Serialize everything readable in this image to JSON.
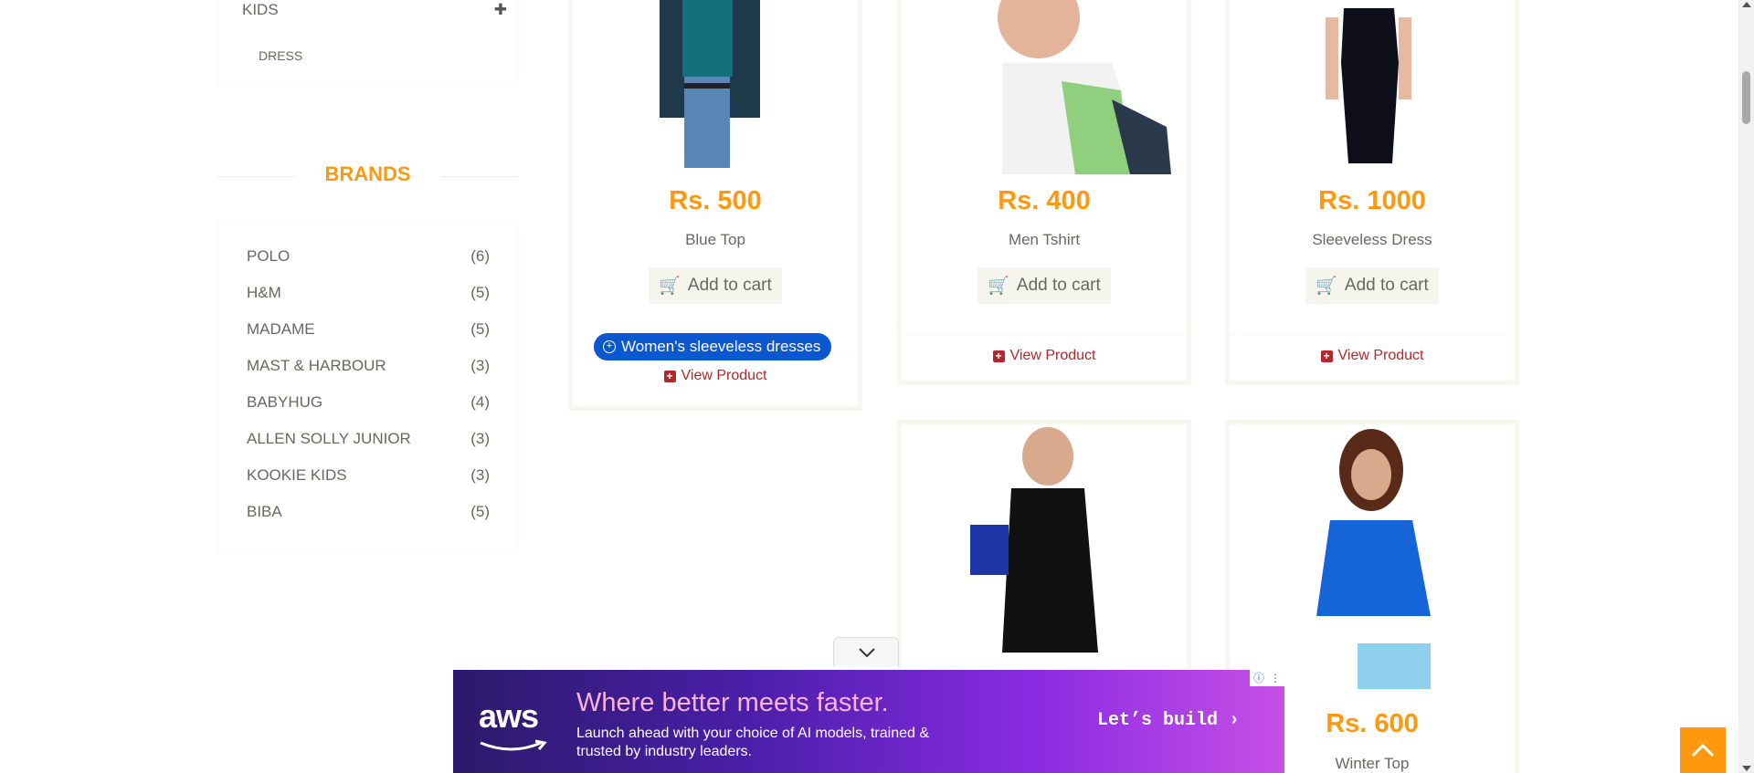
{
  "sidebar": {
    "category": {
      "label": "KIDS",
      "sub_item": "DRESS"
    },
    "brands_title": "BRANDS",
    "brands": [
      {
        "name": "POLO",
        "count": "(6)"
      },
      {
        "name": "H&M",
        "count": "(5)"
      },
      {
        "name": "MADAME",
        "count": "(5)"
      },
      {
        "name": "MAST & HARBOUR",
        "count": "(3)"
      },
      {
        "name": "BABYHUG",
        "count": "(4)"
      },
      {
        "name": "ALLEN SOLLY JUNIOR",
        "count": "(3)"
      },
      {
        "name": "KOOKIE KIDS",
        "count": "(3)"
      },
      {
        "name": "BIBA",
        "count": "(5)"
      }
    ]
  },
  "products": [
    {
      "price": "Rs. 500",
      "name": "Blue Top",
      "add_label": "Add to cart",
      "view_label": "View Product"
    },
    {
      "price": "Rs. 400",
      "name": "Men Tshirt",
      "add_label": "Add to cart",
      "view_label": "View Product"
    },
    {
      "price": "Rs. 1000",
      "name": "Sleeveless Dress",
      "add_label": "Add to cart",
      "view_label": "View Product"
    },
    {
      "price": "",
      "name": "",
      "add_label": "",
      "view_label": ""
    },
    {
      "price": "Rs. 600",
      "name": "Winter Top",
      "add_label": "",
      "view_label": ""
    }
  ],
  "search_chip": "Women's sleeveless dresses",
  "ad": {
    "brand": "aws",
    "headline": "Where better meets faster.",
    "body": "Launch ahead with your choice of AI models, trained & trusted by industry leaders.",
    "cta": "Let’s build ›"
  },
  "colors": {
    "accent": "#FE980F",
    "view_link": "#B3282D",
    "chip": "#0B57D0"
  }
}
